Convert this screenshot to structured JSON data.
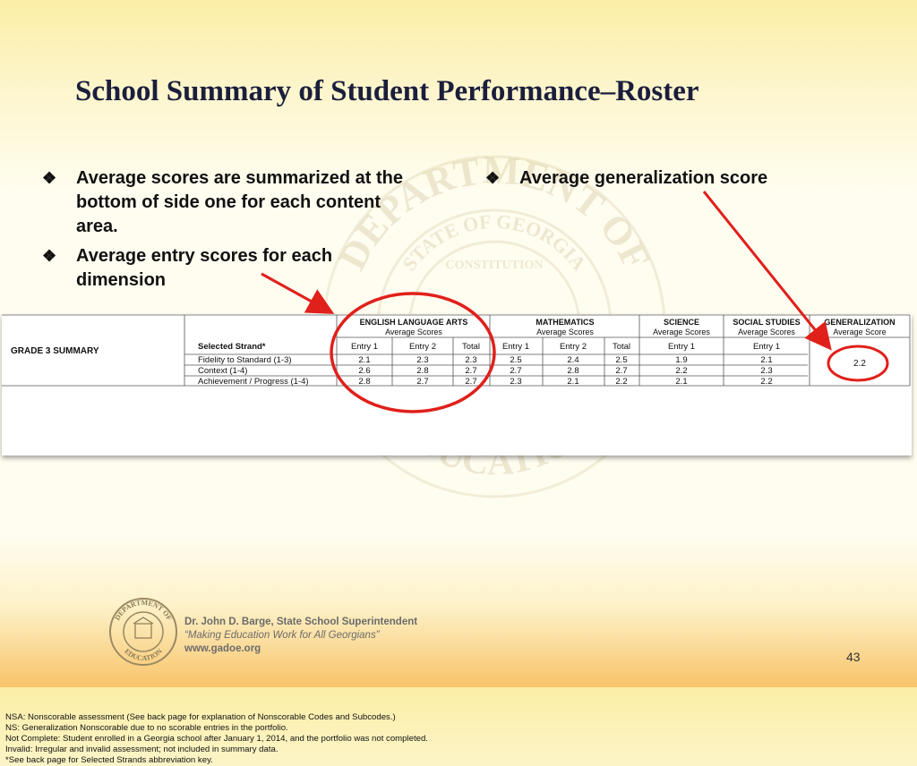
{
  "slide": {
    "title": "School Summary of Student Performance–Roster",
    "bullets_left": [
      "Average scores are summarized at the bottom of side one for each content area.",
      "Average entry scores for each dimension"
    ],
    "bullets_right": [
      "Average generalization score"
    ],
    "bullet_symbol": "❖",
    "page_number": "43",
    "accent_color": "#e0201b"
  },
  "roster": {
    "grade_label": "GRADE 3 SUMMARY",
    "selected_strand_label": "Selected Strand*",
    "content_areas": [
      {
        "name": "ENGLISH LANGUAGE ARTS",
        "sub": "Average Scores"
      },
      {
        "name": "MATHEMATICS",
        "sub": "Average Scores"
      },
      {
        "name": "SCIENCE",
        "sub": "Average Scores"
      },
      {
        "name": "SOCIAL STUDIES",
        "sub": "Average Scores"
      },
      {
        "name": "GENERALIZATION",
        "sub": "Average Score"
      }
    ],
    "column_headers": [
      "Entry 1",
      "Entry 2",
      "Total",
      "Entry 1",
      "Entry 2",
      "Total",
      "Entry 1",
      "Entry 1"
    ],
    "rows": [
      {
        "strand": "Fidelity to Standard (1-3)",
        "values": [
          "2.1",
          "2.3",
          "2.3",
          "2.5",
          "2.4",
          "2.5",
          "1.9",
          "2.1"
        ]
      },
      {
        "strand": "Context (1-4)",
        "values": [
          "2.6",
          "2.8",
          "2.7",
          "2.7",
          "2.8",
          "2.7",
          "2.2",
          "2.3"
        ]
      },
      {
        "strand": "Achievement / Progress (1-4)",
        "values": [
          "2.8",
          "2.7",
          "2.7",
          "2.3",
          "2.1",
          "2.2",
          "2.1",
          "2.2"
        ]
      }
    ],
    "generalization_value": "2.2",
    "notes": [
      "NSA:  Nonscorable assessment (See back page for explanation of Nonscorable Codes and Subcodes.)",
      "NS:  Generalization Nonscorable due to no scorable entries in the portfolio.",
      "Not Complete:  Student enrolled in a Georgia school after January 1, 2014, and the portfolio was not completed.",
      "Invalid:  Irregular and invalid assessment; not included in summary data.",
      "*See back page for Selected Strands abbreviation key."
    ]
  },
  "footer": {
    "name": "Dr. John D. Barge, State School Superintendent",
    "motto": "“Making Education Work for All Georgians”",
    "website": "www.gadoe.org",
    "seal_text_top": "DEPARTMENT OF",
    "seal_text_bottom": "EDUCATION"
  },
  "watermark": {
    "ring_top": "DEPARTMENT OF",
    "inner": "STATE OF GEORGIA",
    "inner2": "CONSTITUTION",
    "ring_bottom": "EDUCATION"
  }
}
